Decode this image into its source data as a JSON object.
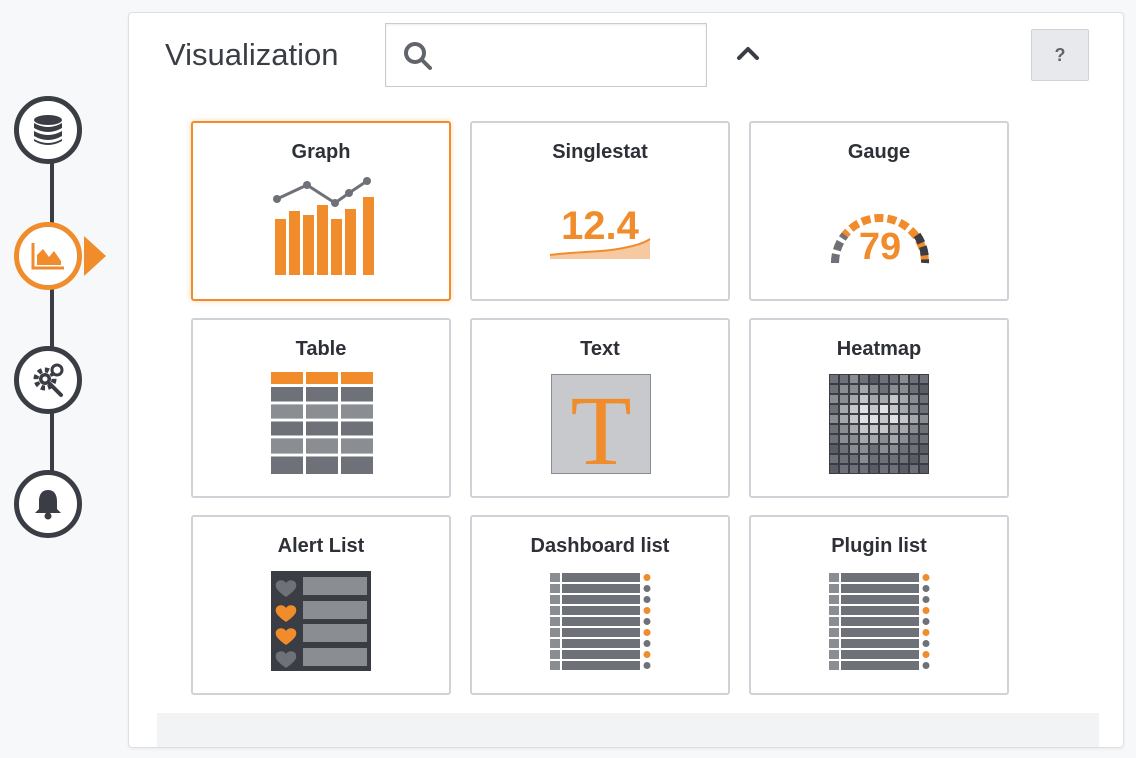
{
  "header": {
    "title": "Visualization",
    "search": {
      "value": "",
      "placeholder": ""
    },
    "help_label": "?"
  },
  "stepper": [
    {
      "icon": "database-icon",
      "active": false
    },
    {
      "icon": "area-chart-icon",
      "active": true
    },
    {
      "icon": "gear-wrench-icon",
      "active": false
    },
    {
      "icon": "bell-icon",
      "active": false
    }
  ],
  "cards": [
    {
      "label": "Graph",
      "selected": true
    },
    {
      "label": "Singlestat",
      "value": "12.4"
    },
    {
      "label": "Gauge",
      "value": "79"
    },
    {
      "label": "Table"
    },
    {
      "label": "Text",
      "glyph": "T"
    },
    {
      "label": "Heatmap"
    },
    {
      "label": "Alert List"
    },
    {
      "label": "Dashboard list"
    },
    {
      "label": "Plugin list"
    }
  ],
  "colors": {
    "accent": "#f08c2c",
    "dark": "#3a3d44",
    "grey": "#6e7177"
  }
}
